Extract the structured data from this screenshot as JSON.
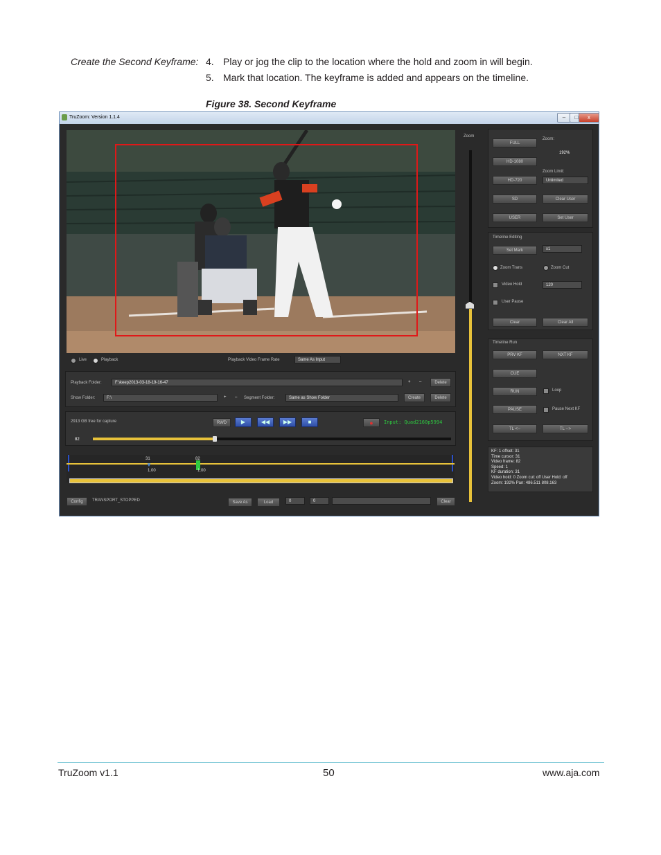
{
  "doc": {
    "step_label": "Create the Second Keyframe:",
    "steps": [
      {
        "num": "4.",
        "text": "Play or jog the clip to the location where the hold and zoom in will begin."
      },
      {
        "num": "5.",
        "text": "Mark that location. The keyframe is added and appears on the timeline."
      }
    ],
    "figure_caption": "Figure 38. Second Keyframe"
  },
  "app": {
    "title": "TruZoom: Version 1.1.4",
    "window_buttons": {
      "minimize": "–",
      "maximize": "□",
      "close": "x"
    },
    "source": {
      "live": "Live",
      "playback": "Playback",
      "frame_rate_label": "Playback Video Frame Rate",
      "frame_rate_value": "Same As Input"
    },
    "folders": {
      "playback_label": "Playback Folder:",
      "playback_value": "F:\\keep2013-03-18-19-16-47",
      "show_label": "Show Folder:",
      "show_value": "F:\\",
      "segment_label": "Segment Folder:",
      "segment_value": "Same as Show Folder",
      "plus": "+",
      "minus": "–",
      "delete": "Delete",
      "create": "Create"
    },
    "transport": {
      "free_space": "2913 GB free for capture",
      "rwd": "RWD",
      "input": "Input: Quad2160p5994",
      "frame": "82",
      "status": "TRANSPORT_STOPPED",
      "progress": 0.34
    },
    "timeline": {
      "kf1_label": "31",
      "kf1_speed": "1.00",
      "kf2_label": "82",
      "kf2_speed": "1.00"
    },
    "bottom": {
      "config": "Config",
      "save_as": "Save As",
      "load": "Load",
      "val1": "0",
      "val2": "0",
      "clear": "Clear"
    },
    "zoom_label": "Zoom",
    "zoom_slider_level": 0.55,
    "presets": {
      "full": "FULL",
      "hd1080": "HD-1080",
      "hd720": "HD-720",
      "sd": "SD",
      "user": "USER",
      "zoom_label": "Zoom:",
      "zoom_value": "192%",
      "zoom_limit_label": "Zoom Limit:",
      "zoom_limit_value": "Unlimited",
      "clear_user": "Clear User",
      "set_user": "Set User"
    },
    "editing": {
      "title": "Timeline Editing",
      "set_mark": "Set Mark",
      "multiplier": "x1",
      "zoom_trans": "Zoom Trans",
      "zoom_cut": "Zoom Cut",
      "video_hold": "Video Hold",
      "video_hold_value": "120",
      "user_pause": "User Pause",
      "clear": "Clear",
      "clear_all": "Clear All"
    },
    "run": {
      "title": "Timeline Run",
      "prv_kf": "PRV KF",
      "nxt_kf": "NXT KF",
      "cue": "CUE",
      "run": "RUN",
      "loop": "Loop",
      "pause": "PAUSE",
      "pause_next_kf": "Pause Next KF",
      "tl_back": "TL <--",
      "tl_fwd": "TL -->"
    },
    "info": [
      "KF: 1 offset: 31",
      "Time cursor: 31",
      "Video frame: 82",
      "Speed: 1",
      "KF duration: 31",
      "Video hold: 0 Zoom cut: off User Hold: off",
      "Zoom: 192% Pan: 486.511 808.163"
    ]
  },
  "footer": {
    "left": "TruZoom v1.1",
    "page": "50",
    "right": "www.aja.com"
  },
  "colors": {
    "accent_yellow": "#e8c23a",
    "input_green": "#2ecc40",
    "zoom_box_red": "#e01818",
    "footer_rule": "#7cc8d6"
  }
}
